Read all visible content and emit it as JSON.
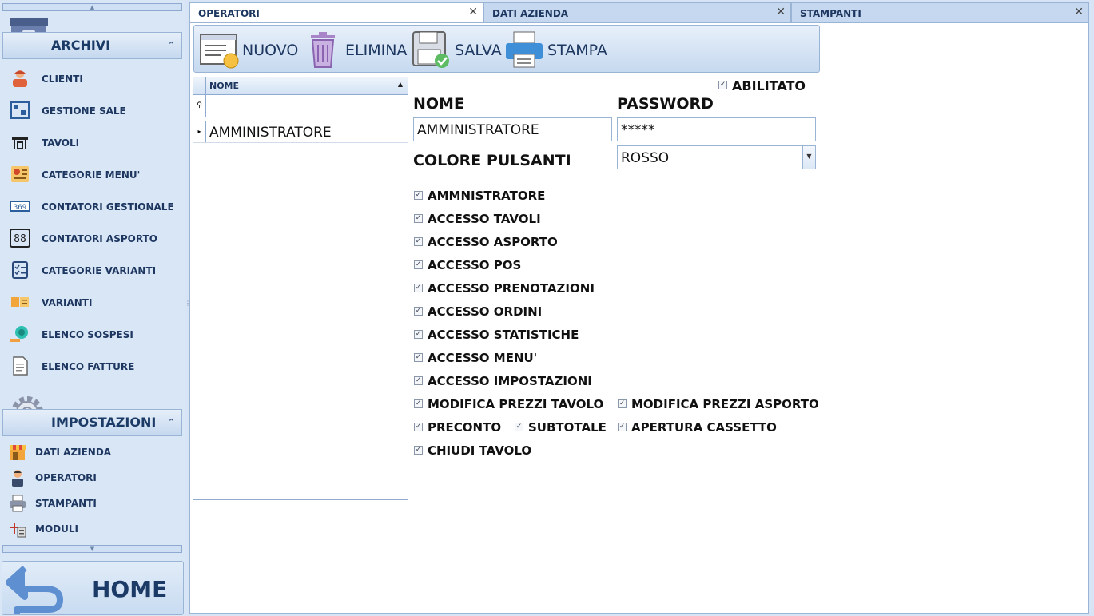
{
  "sidebar": {
    "archivi": {
      "title": "ARCHIVI",
      "items": [
        {
          "label": "CLIENTI",
          "icon": "client-icon"
        },
        {
          "label": "GESTIONE SALE",
          "icon": "room-plan-icon"
        },
        {
          "label": "TAVOLI",
          "icon": "table-icon"
        },
        {
          "label": "CATEGORIE MENU'",
          "icon": "menu-category-icon"
        },
        {
          "label": "CONTATORI GESTIONALE",
          "icon": "counter-icon"
        },
        {
          "label": "CONTATORI ASPORTO",
          "icon": "digital-counter-icon"
        },
        {
          "label": "CATEGORIE VARIANTI",
          "icon": "checklist-icon"
        },
        {
          "label": "VARIANTI",
          "icon": "variants-icon"
        },
        {
          "label": "ELENCO SOSPESI",
          "icon": "coin-hand-icon"
        },
        {
          "label": "ELENCO FATTURE",
          "icon": "invoice-icon"
        }
      ]
    },
    "impostazioni": {
      "title": "IMPOSTAZIONI",
      "items": [
        {
          "label": "DATI AZIENDA",
          "icon": "shop-icon"
        },
        {
          "label": "OPERATORI",
          "icon": "operator-icon"
        },
        {
          "label": "STAMPANTI",
          "icon": "printer-icon"
        },
        {
          "label": "MODULI",
          "icon": "modules-icon"
        }
      ]
    },
    "home_label": "HOME"
  },
  "tabs": [
    {
      "label": "OPERATORI",
      "active": true
    },
    {
      "label": "DATI AZIENDA",
      "active": false
    },
    {
      "label": "STAMPANTI",
      "active": false
    }
  ],
  "toolbar": {
    "new_label": "NUOVO",
    "delete_label": "ELIMINA",
    "save_label": "SALVA",
    "print_label": "STAMPA"
  },
  "grid": {
    "column_header": "NOME",
    "rows": [
      "AMMINISTRATORE"
    ]
  },
  "form": {
    "enabled_label": "ABILITATO",
    "name_label": "NOME",
    "name_value": "AMMINISTRATORE",
    "password_label": "PASSWORD",
    "password_value": "*****",
    "color_label": "COLORE PULSANTI",
    "color_value": "ROSSO",
    "permissions": {
      "amministratore": "AMMNISTRATORE",
      "accesso_tavoli": "ACCESSO TAVOLI",
      "accesso_asporto": "ACCESSO ASPORTO",
      "accesso_pos": "ACCESSO POS",
      "accesso_prenotazioni": "ACCESSO PRENOTAZIONI",
      "accesso_ordini": "ACCESSO ORDINI",
      "accesso_statistiche": "ACCESSO STATISTICHE",
      "accesso_menu": "ACCESSO MENU'",
      "accesso_impostazioni": "ACCESSO IMPOSTAZIONI",
      "modifica_prezzi_tavolo": "MODIFICA PREZZI TAVOLO",
      "modifica_prezzi_asporto": "MODIFICA PREZZI ASPORTO",
      "preconto": "PRECONTO",
      "subtotale": "SUBTOTALE",
      "apertura_cassetto": "APERTURA CASSETTO",
      "chiudi_tavolo": "CHIUDI TAVOLO"
    },
    "check_mark": "✓"
  },
  "colors": {
    "sidebar_bg": "#d9e6f6",
    "header_text": "#1b3a66",
    "panel_border": "#9ab4d6"
  }
}
